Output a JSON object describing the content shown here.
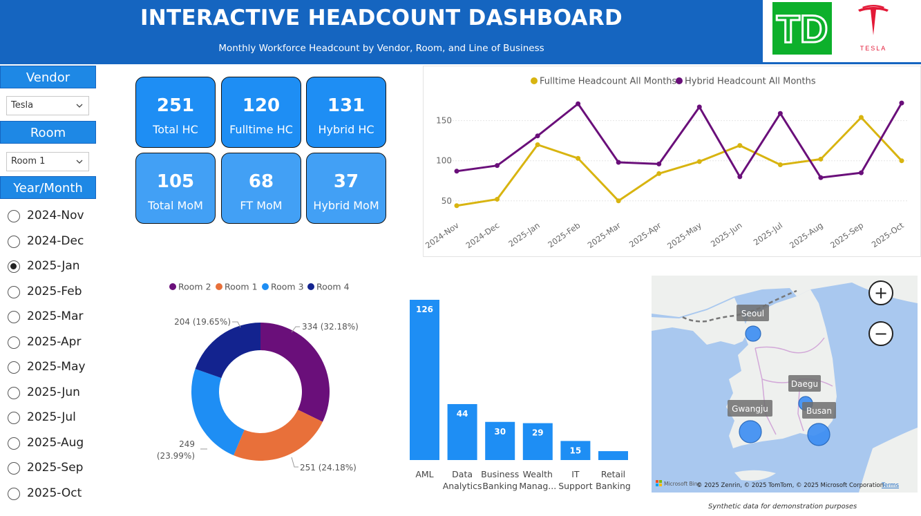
{
  "header": {
    "title": "INTERACTIVE HEADCOUNT DASHBOARD",
    "subtitle": "Monthly Workforce Headcount by Vendor, Room, and Line of Business",
    "td_logo_text": "TD",
    "tesla_logo_text": "TESLA"
  },
  "slicers": {
    "vendor": {
      "label": "Vendor",
      "selected": "Tesla"
    },
    "room": {
      "label": "Room",
      "selected": "Room 1"
    },
    "year_month": {
      "label": "Year/Month",
      "options": [
        {
          "label": "2024-Nov",
          "checked": false
        },
        {
          "label": "2024-Dec",
          "checked": false
        },
        {
          "label": "2025-Jan",
          "checked": true
        },
        {
          "label": "2025-Feb",
          "checked": false
        },
        {
          "label": "2025-Mar",
          "checked": false
        },
        {
          "label": "2025-Apr",
          "checked": false
        },
        {
          "label": "2025-May",
          "checked": false
        },
        {
          "label": "2025-Jun",
          "checked": false
        },
        {
          "label": "2025-Jul",
          "checked": false
        },
        {
          "label": "2025-Aug",
          "checked": false
        },
        {
          "label": "2025-Sep",
          "checked": false
        },
        {
          "label": "2025-Oct",
          "checked": false
        }
      ]
    }
  },
  "kpis": [
    {
      "value": "251",
      "label": "Total HC"
    },
    {
      "value": "120",
      "label": "Fulltime HC"
    },
    {
      "value": "131",
      "label": "Hybrid HC"
    },
    {
      "value": "105",
      "label": "Total MoM"
    },
    {
      "value": "68",
      "label": "FT MoM"
    },
    {
      "value": "37",
      "label": "Hybrid MoM"
    }
  ],
  "colors": {
    "header_blue": "#1565c0",
    "kpi_blue": "#1e8ef4",
    "fulltime": "#d8b410",
    "hybrid": "#6a0f7a",
    "room2": "#6a0f7a",
    "room1": "#e8703a",
    "room3": "#1e8ef4",
    "room4": "#13238f",
    "bar": "#1e8ef4"
  },
  "chart_data": [
    {
      "type": "line",
      "x": [
        "2024-Nov",
        "2024-Dec",
        "2025-Jan",
        "2025-Feb",
        "2025-Mar",
        "2025-Apr",
        "2025-May",
        "2025-Jun",
        "2025-Jul",
        "2025-Aug",
        "2025-Sep",
        "2025-Oct"
      ],
      "series": [
        {
          "name": "Fulltime Headcount All Months",
          "values": [
            44,
            52,
            120,
            103,
            50,
            84,
            99,
            119,
            95,
            102,
            154,
            100
          ]
        },
        {
          "name": "Hybrid Headcount All Months",
          "values": [
            87,
            94,
            131,
            171,
            98,
            96,
            167,
            80,
            159,
            79,
            85,
            172
          ]
        }
      ],
      "yticks": [
        50,
        100,
        150
      ],
      "ylim": [
        30,
        185
      ],
      "legend": "top-center",
      "grid": true
    },
    {
      "type": "pie",
      "donut": true,
      "legend": [
        {
          "name": "Room 2"
        },
        {
          "name": "Room 1"
        },
        {
          "name": "Room 3"
        },
        {
          "name": "Room 4"
        }
      ],
      "slices": [
        {
          "name": "Room 2",
          "value": 334,
          "label": "334 (32.18%)"
        },
        {
          "name": "Room 1",
          "value": 251,
          "label": "251 (24.18%)"
        },
        {
          "name": "Room 3",
          "value": 249,
          "label_line1": "249",
          "label_line2": "(23.99%)"
        },
        {
          "name": "Room 4",
          "value": 204,
          "label": "204 (19.65%)"
        }
      ]
    },
    {
      "type": "bar",
      "categories": [
        {
          "line1": "AML",
          "line2": ""
        },
        {
          "line1": "Data",
          "line2": "Analytics"
        },
        {
          "line1": "Business",
          "line2": "Banking"
        },
        {
          "line1": "Wealth",
          "line2": "Manag..."
        },
        {
          "line1": "IT",
          "line2": "Support"
        },
        {
          "line1": "Retail",
          "line2": "Banking"
        }
      ],
      "values": [
        126,
        44,
        30,
        29,
        15,
        7
      ],
      "labels": [
        "126",
        "44",
        "30",
        "29",
        "15",
        ""
      ],
      "ylim": [
        0,
        126
      ]
    }
  ],
  "map": {
    "cities": [
      {
        "name": "Seoul"
      },
      {
        "name": "Daegu"
      },
      {
        "name": "Gwangju"
      },
      {
        "name": "Busan"
      }
    ],
    "zoom_in": "+",
    "zoom_out": "−",
    "brand": "Microsoft Bing",
    "copyright": "© 2025 Zenrin, © 2025 TomTom, © 2025 Microsoft Corporation",
    "terms": "Terms"
  },
  "footnote": "Synthetic data for demonstration purposes"
}
